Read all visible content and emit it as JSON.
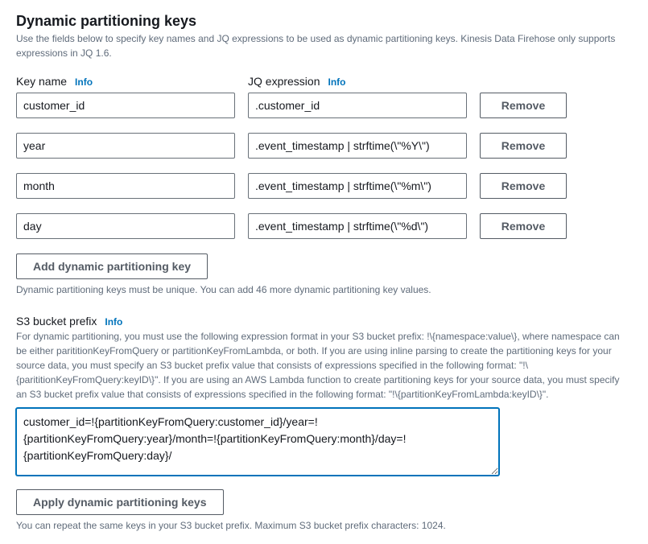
{
  "section": {
    "title": "Dynamic partitioning keys",
    "description": "Use the fields below to specify key names and JQ expressions to be used as dynamic partitioning keys. Kinesis Data Firehose only supports expressions in JQ 1.6."
  },
  "columns": {
    "key_name_label": "Key name",
    "jq_label": "JQ expression",
    "info_label": "Info"
  },
  "rows": [
    {
      "key_name": "customer_id",
      "jq": ".customer_id",
      "remove_label": "Remove"
    },
    {
      "key_name": "year",
      "jq": ".event_timestamp | strftime(\\\"%Y\\\")",
      "remove_label": "Remove"
    },
    {
      "key_name": "month",
      "jq": ".event_timestamp | strftime(\\\"%m\\\")",
      "remove_label": "Remove"
    },
    {
      "key_name": "day",
      "jq": ".event_timestamp | strftime(\\\"%d\\\")",
      "remove_label": "Remove"
    }
  ],
  "add_button_label": "Add dynamic partitioning key",
  "uniqueness_hint": "Dynamic partitioning keys must be unique. You can add 46 more dynamic partitioning key values.",
  "prefix": {
    "title": "S3 bucket prefix",
    "info_label": "Info",
    "description": "For dynamic partitioning, you must use the following expression format in your S3 bucket prefix: !\\{namespace:value\\}, where namespace can be either parititionKeyFromQuery or partitionKeyFromLambda, or both. If you are using inline parsing to create the partitioning keys for your source data, you must specify an S3 bucket prefix value that consists of expressions specified in the following format: \"!\\{parititionKeyFromQuery:keyID\\}\". If you are using an AWS Lambda function to create partitioning keys for your source data, you must specify an S3 bucket prefix value that consists of expressions specified in the following format: \"!\\{partitionKeyFromLambda:keyID\\}\".",
    "value": "customer_id=!{partitionKeyFromQuery:customer_id}/year=!{partitionKeyFromQuery:year}/month=!{partitionKeyFromQuery:month}/day=!{partitionKeyFromQuery:day}/"
  },
  "apply_button_label": "Apply dynamic partitioning keys",
  "repeat_hint": "You can repeat the same keys in your S3 bucket prefix. Maximum S3 bucket prefix characters: 1024."
}
